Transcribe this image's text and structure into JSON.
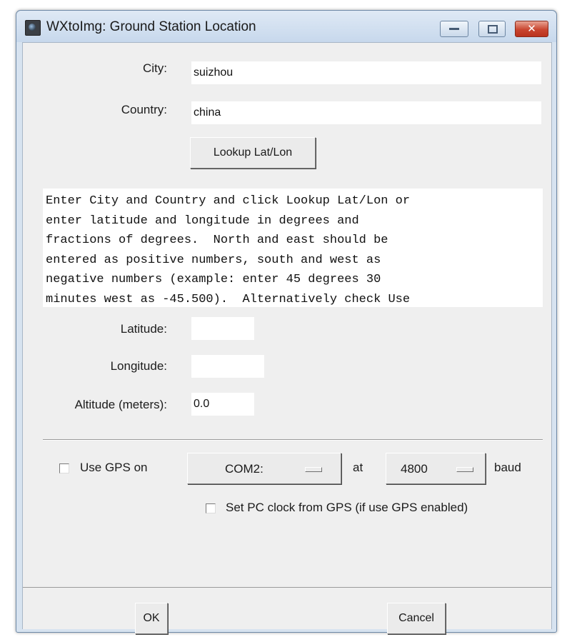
{
  "window": {
    "title": "WXtoImg: Ground Station Location"
  },
  "form": {
    "city_label": "City:",
    "city_value": "suizhou",
    "country_label": "Country:",
    "country_value": "china",
    "lookup_label": "Lookup Lat/Lon",
    "info_text": "Enter City and Country and click Lookup Lat/Lon or\nenter latitude and longitude in degrees and\nfractions of degrees.  North and east should be\nentered as positive numbers, south and west as\nnegative numbers (example: enter 45 degrees 30\nminutes west as -45.500).  Alternatively check Use",
    "latitude_label": "Latitude:",
    "latitude_value": "",
    "longitude_label": "Longitude:",
    "longitude_value": "",
    "altitude_label": "Altitude (meters):",
    "altitude_value": "0.0"
  },
  "gps": {
    "use_gps_label": "Use GPS on",
    "use_gps_checked": false,
    "port_value": "COM2:",
    "at_label": "at",
    "baud_value": "4800",
    "baud_label": "baud",
    "set_clock_label": "Set PC clock from GPS (if use GPS enabled)",
    "set_clock_checked": false
  },
  "buttons": {
    "ok_label": "OK",
    "cancel_label": "Cancel"
  },
  "icons": {
    "app": "wxtoimg-app-icon",
    "minimize": "minimize-icon",
    "maximize": "maximize-icon",
    "close": "close-icon"
  }
}
